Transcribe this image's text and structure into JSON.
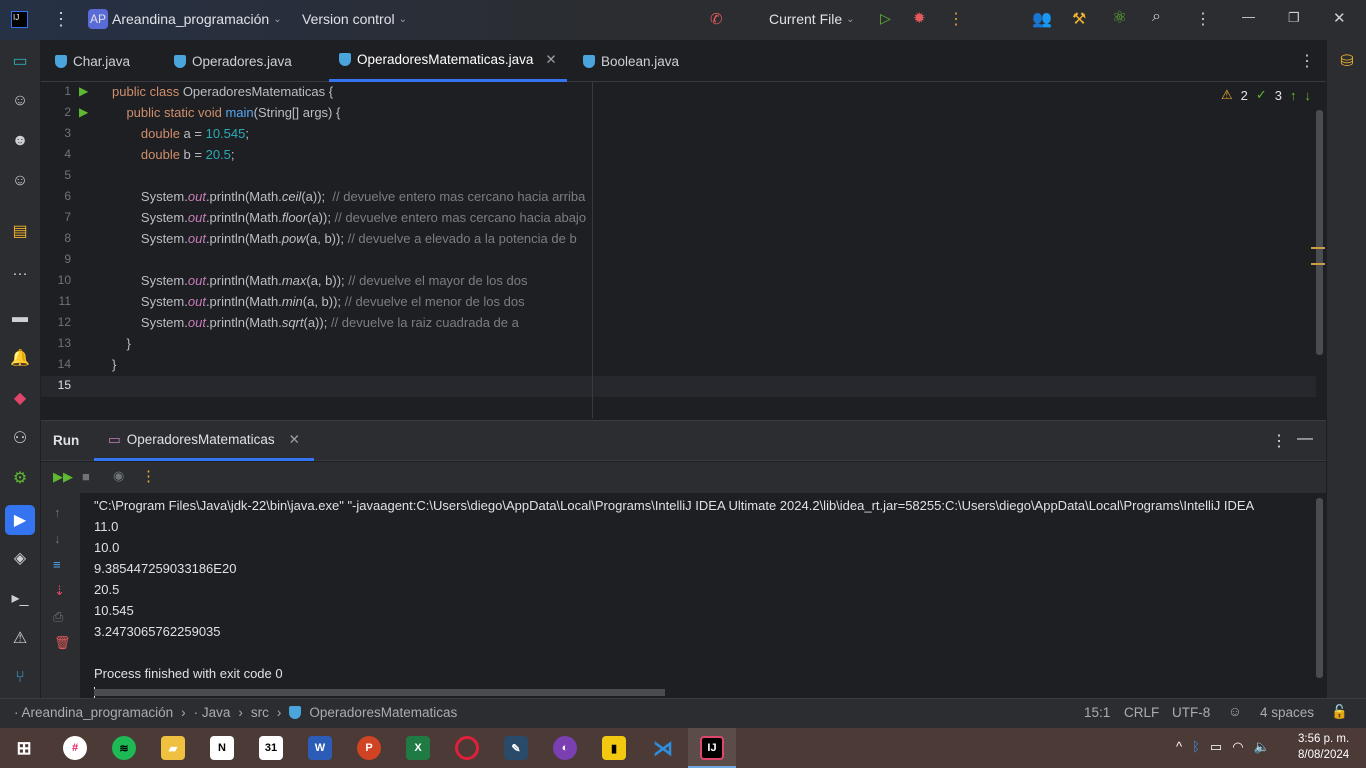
{
  "titlebar": {
    "project_initials": "AP",
    "project_name": "Areandina_programación",
    "vcs": "Version control",
    "run_config": "Current File"
  },
  "tabs": [
    {
      "label": "Char.java"
    },
    {
      "label": "Operadores.java"
    },
    {
      "label": "OperadoresMatematicas.java",
      "active": true
    },
    {
      "label": "Boolean.java"
    }
  ],
  "inspections": {
    "warnings": "2",
    "ok": "3"
  },
  "editor": {
    "lines": [
      [
        [
          "public class ",
          "kw"
        ],
        [
          "OperadoresMatematicas {",
          ""
        ]
      ],
      [
        [
          "    public static void ",
          "kw"
        ],
        [
          "main",
          "fn"
        ],
        [
          "(String[] args) {",
          ""
        ]
      ],
      [
        [
          "        double ",
          "kw"
        ],
        [
          "a = ",
          ""
        ],
        [
          "10.545",
          "num"
        ],
        [
          ";",
          ""
        ]
      ],
      [
        [
          "        double ",
          "kw"
        ],
        [
          "b = ",
          ""
        ],
        [
          "20.5",
          "num"
        ],
        [
          ";",
          ""
        ]
      ],
      [],
      [
        [
          "        System.",
          ""
        ],
        [
          "out",
          "st"
        ],
        [
          ".println(Math.",
          ""
        ],
        [
          "ceil",
          "it"
        ],
        [
          "(a));  ",
          ""
        ],
        [
          "// devuelve entero mas cercano hacia arriba",
          "cm"
        ]
      ],
      [
        [
          "        System.",
          ""
        ],
        [
          "out",
          "st"
        ],
        [
          ".println(Math.",
          ""
        ],
        [
          "floor",
          "it"
        ],
        [
          "(a)); ",
          ""
        ],
        [
          "// devuelve entero mas cercano hacia abajo",
          "cm"
        ]
      ],
      [
        [
          "        System.",
          ""
        ],
        [
          "out",
          "st"
        ],
        [
          ".println(Math.",
          ""
        ],
        [
          "pow",
          "it"
        ],
        [
          "(a, b)); ",
          ""
        ],
        [
          "// devuelve a elevado a la potencia de b",
          "cm"
        ]
      ],
      [],
      [
        [
          "        System.",
          ""
        ],
        [
          "out",
          "st"
        ],
        [
          ".println(Math.",
          ""
        ],
        [
          "max",
          "it"
        ],
        [
          "(a, b)); ",
          ""
        ],
        [
          "// devuelve el mayor de los dos",
          "cm"
        ]
      ],
      [
        [
          "        System.",
          ""
        ],
        [
          "out",
          "st"
        ],
        [
          ".println(Math.",
          ""
        ],
        [
          "min",
          "it"
        ],
        [
          "(a, b)); ",
          ""
        ],
        [
          "// devuelve el menor de los dos",
          "cm"
        ]
      ],
      [
        [
          "        System.",
          ""
        ],
        [
          "out",
          "st"
        ],
        [
          ".println(Math.",
          ""
        ],
        [
          "sqrt",
          "it"
        ],
        [
          "(a)); ",
          ""
        ],
        [
          "// devuelve la raiz cuadrada de a",
          "cm"
        ]
      ],
      [
        [
          "    }",
          ""
        ]
      ],
      [
        [
          "}",
          ""
        ]
      ],
      []
    ]
  },
  "run": {
    "title": "Run",
    "tab": "OperadoresMatematicas",
    "output": [
      "\"C:\\Program Files\\Java\\jdk-22\\bin\\java.exe\" \"-javaagent:C:\\Users\\diego\\AppData\\Local\\Programs\\IntelliJ IDEA Ultimate 2024.2\\lib\\idea_rt.jar=58255:C:\\Users\\diego\\AppData\\Local\\Programs\\IntelliJ IDEA",
      "11.0",
      "10.0",
      "9.385447259033186E20",
      "20.5",
      "10.545",
      "3.2473065762259035",
      "",
      "Process finished with exit code 0"
    ]
  },
  "status": {
    "breadcrumb": [
      "Areandina_programación",
      "Java",
      "src",
      "OperadoresMatematicas"
    ],
    "position": "15:1",
    "line_sep": "CRLF",
    "encoding": "UTF-8",
    "indent": "4 spaces"
  },
  "taskbar": {
    "time": "3:56 p. m.",
    "date": "8/08/2024"
  }
}
